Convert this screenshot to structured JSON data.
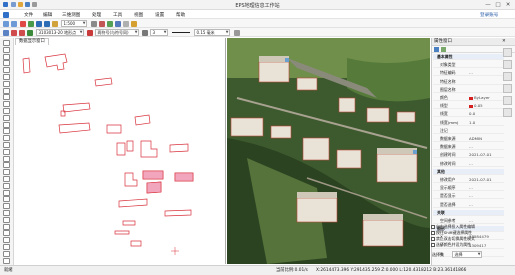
{
  "app": {
    "title": "EPS地理信息工作站",
    "window_controls": [
      "—",
      "□",
      "✕"
    ]
  },
  "menu": {
    "items": [
      "文件",
      "编辑",
      "三维测图",
      "处理",
      "工具",
      "视图",
      "设置",
      "帮助"
    ],
    "user": "登录账号"
  },
  "toolbar": {
    "scale": "1:500",
    "layer_code": "3103013-20 地形点",
    "symbol": "两符号(与符号同)",
    "linetype": "0.15 毫米",
    "layer": "3"
  },
  "drawing": {
    "tab_label": "数据显示窗口"
  },
  "panel": {
    "title": "属性窗口",
    "rows": [
      {
        "k": "基本属性",
        "v": "",
        "group": true
      },
      {
        "k": "对象类型",
        "v": ""
      },
      {
        "k": "特征编码",
        "v": "…"
      },
      {
        "k": "特征名称",
        "v": ""
      },
      {
        "k": "图层名称",
        "v": ""
      },
      {
        "k": "颜色",
        "v": "ByLayer",
        "swatch": "#d62020"
      },
      {
        "k": "线型",
        "v": "0.05",
        "swatch": "#d62020"
      },
      {
        "k": "线宽",
        "v": "0.0"
      },
      {
        "k": "线宽(mm)",
        "v": "1.0"
      },
      {
        "k": "注记",
        "v": ""
      },
      {
        "k": "数据来源",
        "v": "ADMIN"
      },
      {
        "k": "数据来源",
        "v": "…"
      },
      {
        "k": "创建时间",
        "v": "2021-07-01"
      },
      {
        "k": "修改时间",
        "v": "…"
      },
      {
        "k": "其他",
        "v": "",
        "group": true
      },
      {
        "k": "修改用户",
        "v": "2021-07-01"
      },
      {
        "k": "显示顺序",
        "v": "…"
      },
      {
        "k": "是否显示",
        "v": "…"
      },
      {
        "k": "是否选择",
        "v": "…"
      },
      {
        "k": "关联",
        "v": "",
        "group": true
      },
      {
        "k": "空间参考",
        "v": "…"
      },
      {
        "k": "图形",
        "v": "",
        "group": true
      },
      {
        "k": "X",
        "v": "38584479"
      },
      {
        "k": "Y",
        "v": "4309417"
      },
      {
        "k": "Z",
        "v": "0"
      }
    ],
    "checks": [
      "自由选择投入属性编辑",
      "按住Shift键选择属性",
      "禁止双击切换属性模式",
      "选择颜色并设为属性"
    ],
    "footer": {
      "label": "选择集",
      "value": "选择"
    }
  },
  "status": {
    "left": "就绪",
    "coords": "X:2614473.396 Y:291435.259 Z:0.000 L:120.4318212 B:23.36141866",
    "info": "当前比例:0.01/s"
  }
}
